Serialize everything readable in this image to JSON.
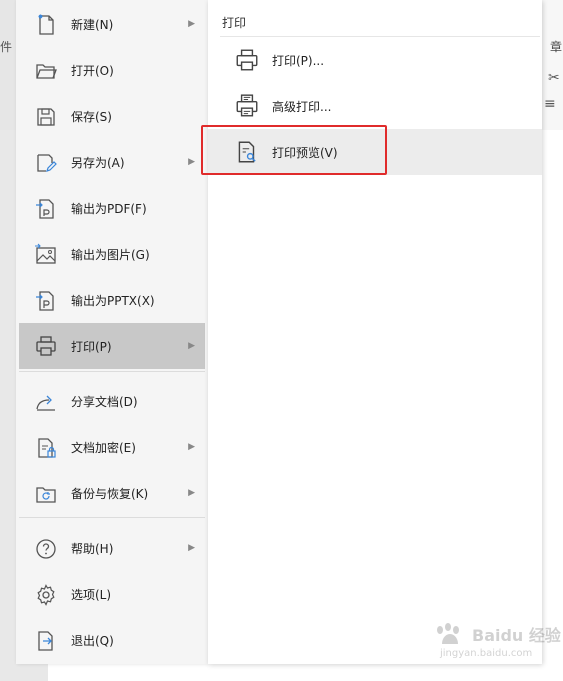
{
  "background": {
    "left_text": "件",
    "right_text": "章",
    "right_icon_1": "✂",
    "right_icon_2": "≡"
  },
  "main_menu": {
    "items": [
      {
        "label": "新建(N)",
        "icon": "new-file-icon",
        "has_submenu": true
      },
      {
        "label": "打开(O)",
        "icon": "folder-open-icon",
        "has_submenu": false
      },
      {
        "label": "保存(S)",
        "icon": "save-icon",
        "has_submenu": false
      },
      {
        "label": "另存为(A)",
        "icon": "save-as-icon",
        "has_submenu": true
      },
      {
        "label": "输出为PDF(F)",
        "icon": "export-pdf-icon",
        "has_submenu": false
      },
      {
        "label": "输出为图片(G)",
        "icon": "export-image-icon",
        "has_submenu": false
      },
      {
        "label": "输出为PPTX(X)",
        "icon": "export-pptx-icon",
        "has_submenu": false
      },
      {
        "label": "打印(P)",
        "icon": "printer-icon",
        "has_submenu": true,
        "active": true
      },
      {
        "label": "分享文档(D)",
        "icon": "share-icon",
        "has_submenu": false
      },
      {
        "label": "文档加密(E)",
        "icon": "encrypt-doc-icon",
        "has_submenu": true
      },
      {
        "label": "备份与恢复(K)",
        "icon": "backup-icon",
        "has_submenu": true
      },
      {
        "label": "帮助(H)",
        "icon": "help-icon",
        "has_submenu": true
      },
      {
        "label": "选项(L)",
        "icon": "gear-icon",
        "has_submenu": false
      },
      {
        "label": "退出(Q)",
        "icon": "exit-icon",
        "has_submenu": false
      }
    ]
  },
  "submenu": {
    "title": "打印",
    "items": [
      {
        "label": "打印(P)...",
        "icon": "printer-icon"
      },
      {
        "label": "高级打印...",
        "icon": "advanced-print-icon"
      },
      {
        "label": "打印预览(V)",
        "icon": "print-preview-icon",
        "hovered": true,
        "highlighted": true
      }
    ]
  },
  "colors": {
    "highlight_border": "#e02b2b",
    "active_item_bg": "#c8c8c8",
    "hover_item_bg": "#ececec"
  },
  "watermark": {
    "main": "Baidu 经验",
    "sub": "jingyan.baidu.com"
  }
}
